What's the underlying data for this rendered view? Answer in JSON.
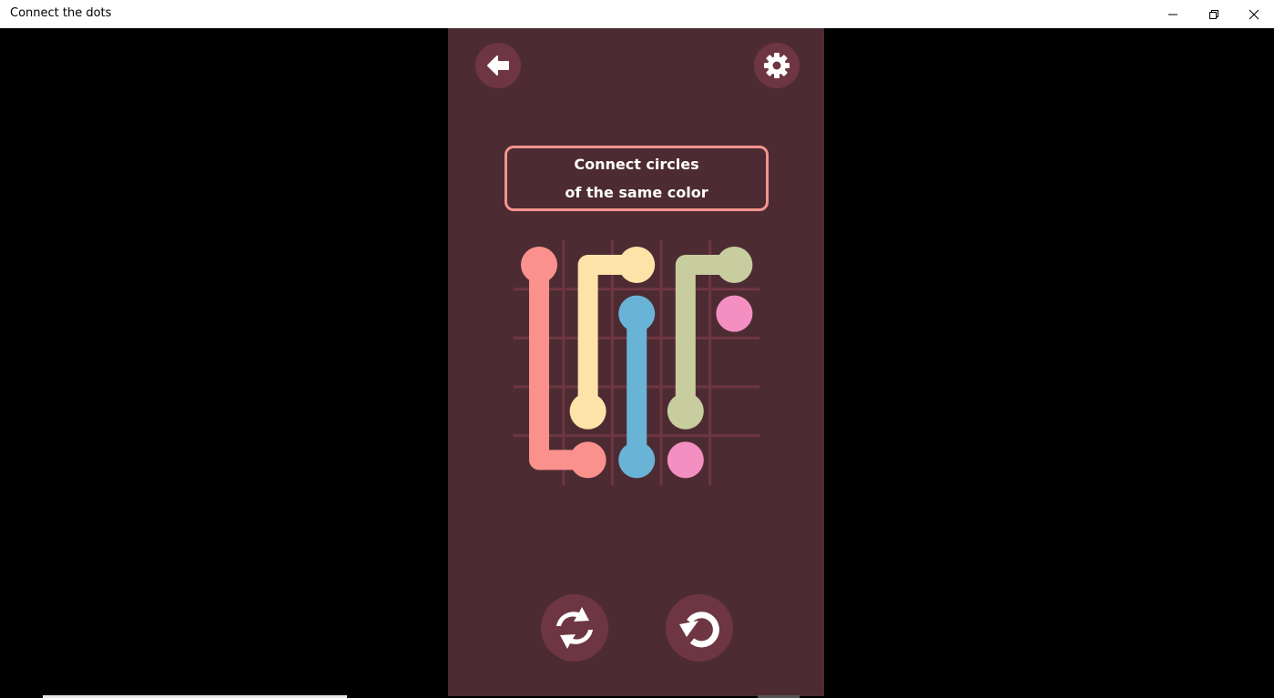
{
  "window": {
    "title": "Connect the dots",
    "controls": [
      "minimize",
      "restore",
      "close"
    ]
  },
  "header": {
    "back_icon": "arrow-left-icon",
    "settings_icon": "gear-icon"
  },
  "instruction": {
    "line1": "Connect circles",
    "line2": "of the same color"
  },
  "board": {
    "rows": 5,
    "cols": 5,
    "colors": {
      "salmon": "#fb918d",
      "yellow": "#fde3a7",
      "blue": "#69b4d6",
      "sage": "#c8cda0",
      "pink": "#f48fc2",
      "grid": "#6e3642",
      "panel": "#4d2b32"
    },
    "paths": [
      {
        "color": "salmon",
        "cells": [
          [
            0,
            0
          ],
          [
            1,
            0
          ],
          [
            2,
            0
          ],
          [
            3,
            0
          ],
          [
            4,
            0
          ],
          [
            4,
            1
          ]
        ],
        "complete": true
      },
      {
        "color": "yellow",
        "cells": [
          [
            0,
            2
          ],
          [
            0,
            1
          ],
          [
            1,
            1
          ],
          [
            2,
            1
          ],
          [
            3,
            1
          ]
        ],
        "complete": true
      },
      {
        "color": "blue",
        "cells": [
          [
            1,
            2
          ],
          [
            2,
            2
          ],
          [
            3,
            2
          ],
          [
            4,
            2
          ]
        ],
        "complete": true
      },
      {
        "color": "sage",
        "cells": [
          [
            0,
            4
          ],
          [
            0,
            3
          ],
          [
            1,
            3
          ],
          [
            2,
            3
          ],
          [
            3,
            3
          ]
        ],
        "complete": true
      },
      {
        "color": "pink",
        "cells": [
          [
            1,
            4
          ]
        ],
        "complete": false
      },
      {
        "color": "pink",
        "cells": [
          [
            4,
            3
          ]
        ],
        "complete": false
      }
    ],
    "endpoints": [
      {
        "color": "salmon",
        "cell": [
          0,
          0
        ]
      },
      {
        "color": "salmon",
        "cell": [
          4,
          1
        ]
      },
      {
        "color": "yellow",
        "cell": [
          0,
          2
        ]
      },
      {
        "color": "yellow",
        "cell": [
          3,
          1
        ]
      },
      {
        "color": "blue",
        "cell": [
          1,
          2
        ]
      },
      {
        "color": "blue",
        "cell": [
          4,
          2
        ]
      },
      {
        "color": "sage",
        "cell": [
          0,
          4
        ]
      },
      {
        "color": "sage",
        "cell": [
          3,
          3
        ]
      },
      {
        "color": "pink",
        "cell": [
          1,
          4
        ]
      },
      {
        "color": "pink",
        "cell": [
          4,
          3
        ]
      }
    ]
  },
  "footer": {
    "shuffle_icon": "refresh-icon",
    "undo_icon": "undo-icon"
  }
}
